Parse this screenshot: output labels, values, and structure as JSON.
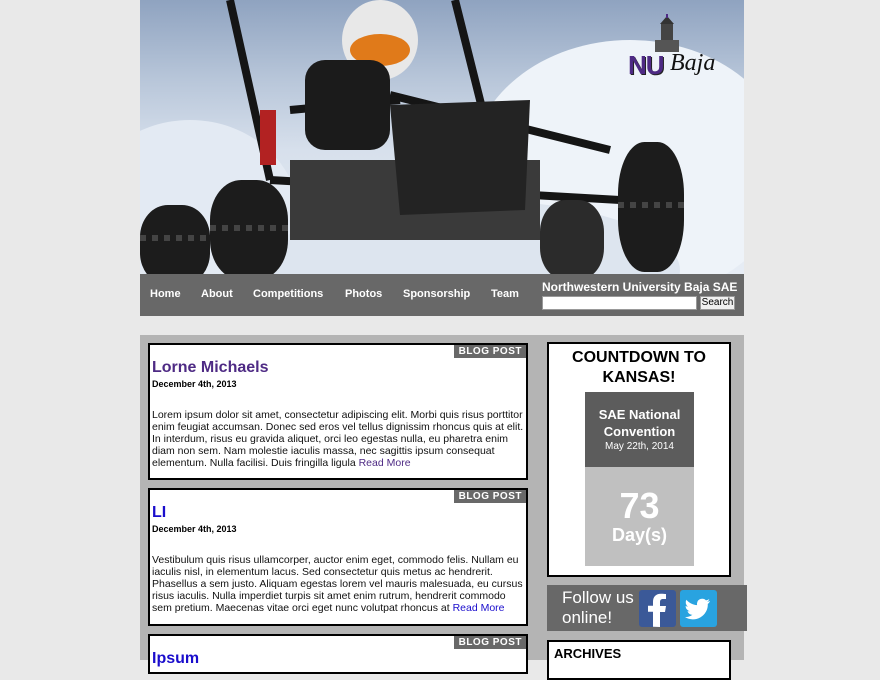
{
  "logo": {
    "nu": "NU",
    "baja": "Baja"
  },
  "nav": {
    "items": [
      "Home",
      "About",
      "Competitions",
      "Photos",
      "Sponsorship",
      "Team"
    ],
    "site_title": "Northwestern University Baja SAE",
    "search_button": "Search",
    "search_value": ""
  },
  "posts": [
    {
      "tag": "BLOG POST",
      "title": "Lorne Michaels",
      "title_color": "#4e2a84",
      "date": "December 4th, 2013",
      "body": "Lorem ipsum dolor sit amet, consectetur adipiscing elit. Morbi quis risus porttitor enim feugiat accumsan. Donec sed eros vel tellus dignissim rhoncus quis at elit. In interdum, risus eu gravida aliquet, orci leo egestas nulla, eu pharetra enim diam non sem. Nam molestie iaculis massa, nec sagittis ipsum consequat elementum. Nulla facilisi. Duis fringilla ligula ",
      "more": "Read More"
    },
    {
      "tag": "BLOG POST",
      "title": "LI",
      "title_color": "#1a0dcc",
      "date": "December 4th, 2013",
      "body": "Vestibulum quis risus ullamcorper, auctor enim eget, commodo felis. Nullam eu iaculis nisl, in elementum lacus. Sed consectetur quis metus ac hendrerit. Phasellus a sem justo. Aliquam egestas lorem vel mauris malesuada, eu cursus risus iaculis. Nulla imperdiet turpis sit amet enim rutrum, hendrerit commodo sem pretium. Maecenas vitae orci eget nunc volutpat rhoncus at ",
      "more": "Read More"
    },
    {
      "tag": "BLOG POST",
      "title": "Ipsum",
      "title_color": "#1a0dcc",
      "date": "",
      "body": "",
      "more": ""
    }
  ],
  "countdown": {
    "title": "COUNTDOWN TO KANSAS!",
    "event_name": "SAE National Convention",
    "event_date": "May 22th, 2014",
    "count": "73",
    "unit": "Day(s)"
  },
  "follow": {
    "text": "Follow us online!",
    "facebook_icon": "facebook-icon",
    "twitter_icon": "twitter-icon"
  },
  "archives": {
    "title": "ARCHIVES"
  },
  "colors": {
    "nav_bg": "#686868",
    "accent_purple": "#4e2a84",
    "content_bg": "#b4b4b4"
  }
}
